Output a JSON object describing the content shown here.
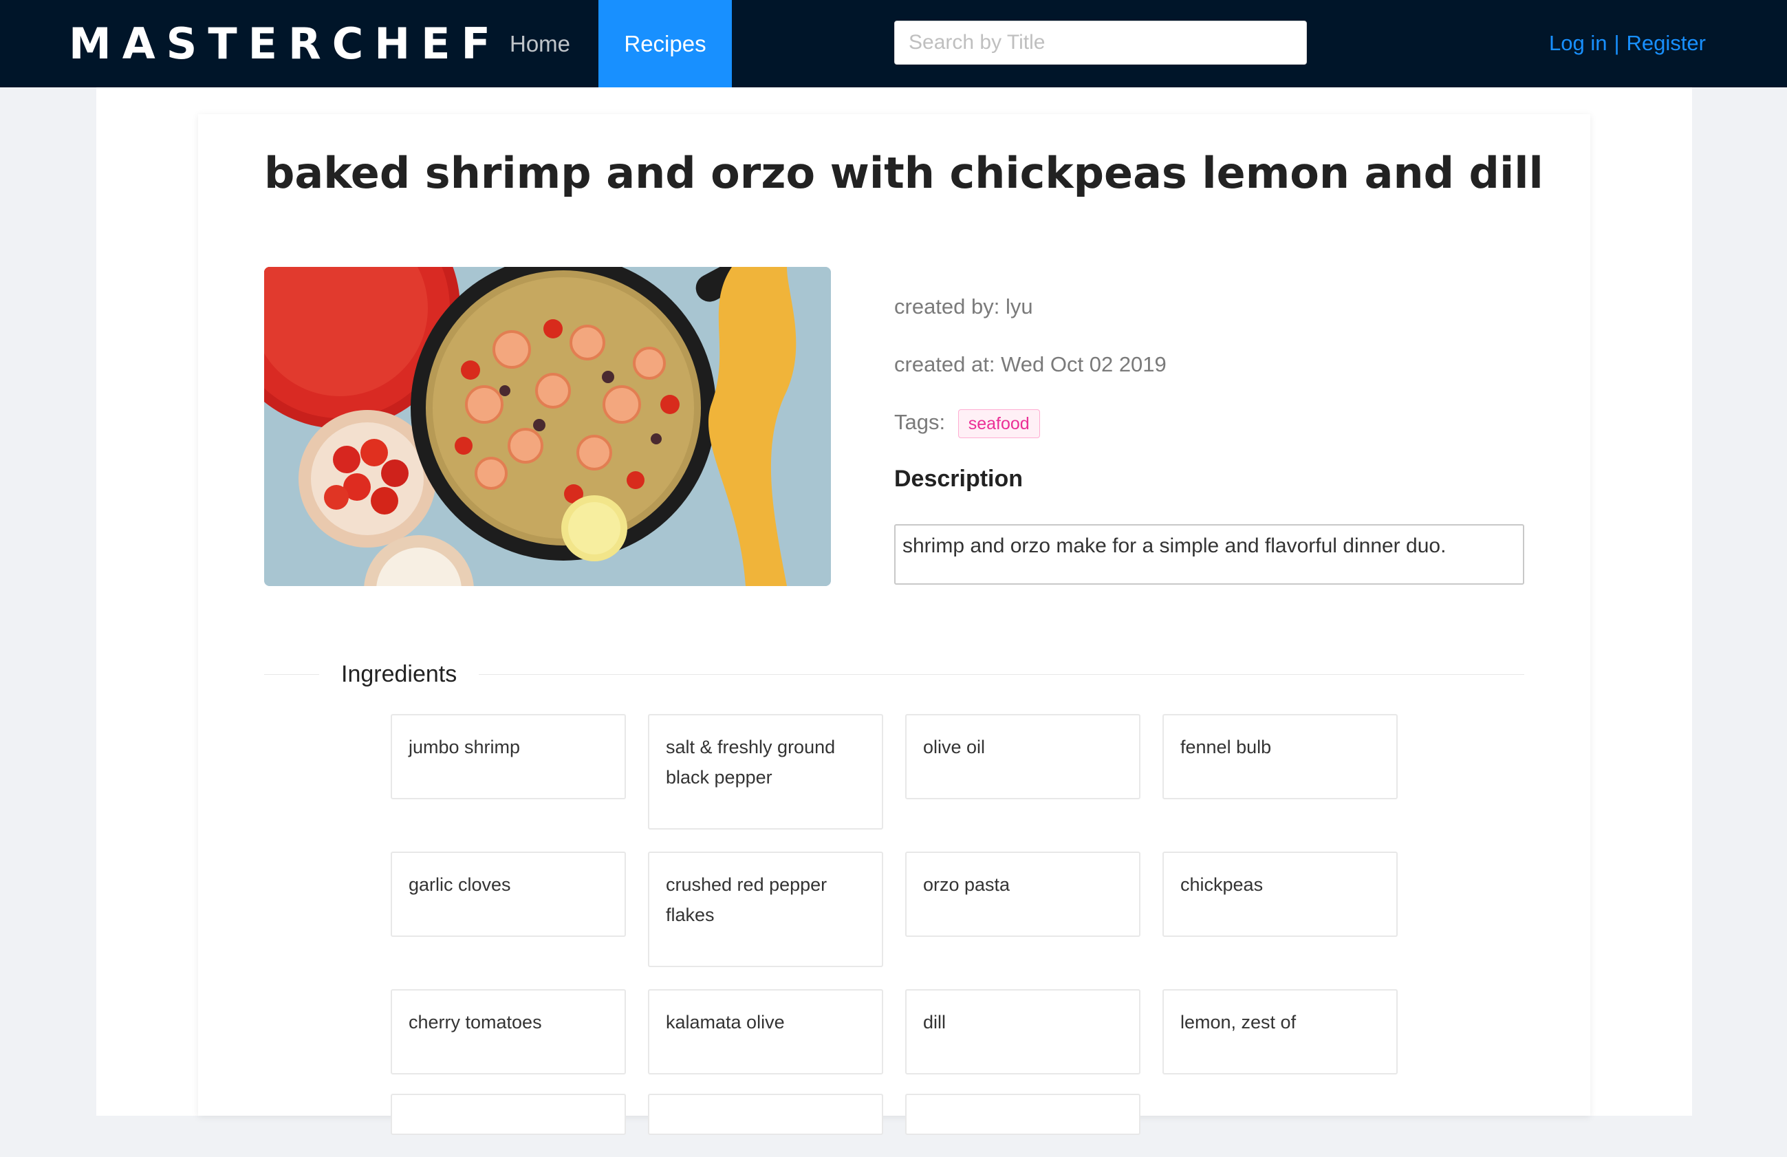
{
  "nav": {
    "brand": "MASTERCHEF",
    "items": [
      {
        "label": "Home",
        "active": false
      },
      {
        "label": "Recipes",
        "active": true
      }
    ],
    "search": {
      "placeholder": "Search by Title",
      "value": ""
    },
    "auth": {
      "login": "Log in",
      "separator": "|",
      "register": "Register"
    },
    "accent_color": "#1890ff",
    "bar_color": "#001529"
  },
  "recipe": {
    "title": "baked shrimp and orzo with chickpeas lemon and dill",
    "created_by": "created by: lyu",
    "created_at": "created at: Wed Oct 02 2019",
    "tags_label": "Tags:",
    "tags": [
      "seafood"
    ],
    "description_heading": "Description",
    "description": "shrimp and orzo make for a simple and flavorful dinner duo."
  },
  "ingredients": {
    "heading": "Ingredients",
    "items": [
      "jumbo shrimp",
      "salt & freshly ground black pepper",
      "olive oil",
      "fennel bulb",
      "garlic cloves",
      "crushed red pepper flakes",
      "orzo pasta",
      "chickpeas",
      "cherry tomatoes",
      "kalamata olive",
      "dill",
      "lemon, zest of"
    ]
  }
}
